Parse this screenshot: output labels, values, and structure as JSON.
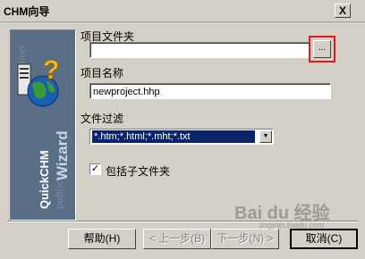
{
  "window": {
    "title": "CHM向导",
    "close_label": "X"
  },
  "banner": {
    "ghost_text": [
      "function",
      "public"
    ],
    "product_label": "QuickCHM",
    "wizard_label": "Wizard"
  },
  "form": {
    "project_folder_label": "项目文件夹",
    "project_folder_value": "",
    "browse_label": "...",
    "project_name_label": "项目名称",
    "project_name_value": "newproject.hhp",
    "file_filter_label": "文件过滤",
    "file_filter_value": "*.htm;*.html;*.mht;*.txt",
    "include_subfolders_label": "包括子文件夹",
    "include_subfolders_checked": true
  },
  "buttons": {
    "help": "帮助(H)",
    "back": "< 上一步(B)",
    "next": "下一步(N) >",
    "cancel": "取消(C)"
  },
  "watermark": {
    "text": "Bai du 经验",
    "sub": "jingyan.baidu.com"
  },
  "colors": {
    "highlight": "#e01a1a",
    "selection": "#0a246a",
    "dialog": "#d4d0c8",
    "banner": "#5a6f86"
  },
  "icons": [
    "help-book-globe-icon",
    "close-icon",
    "dropdown-arrow-icon",
    "checkmark-icon"
  ]
}
